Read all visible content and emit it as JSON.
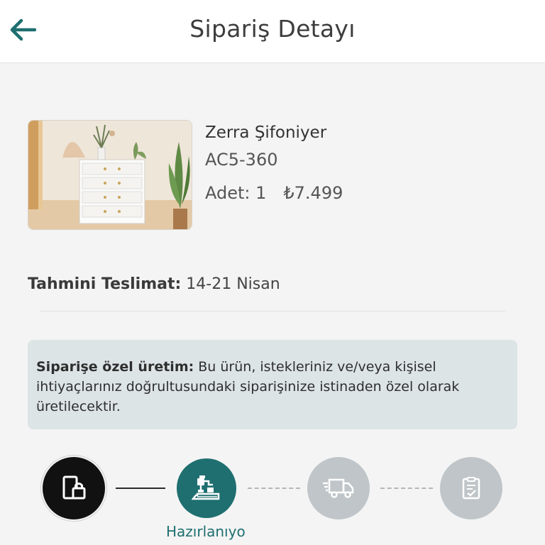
{
  "header": {
    "title": "Sipariş Detayı",
    "back_icon": "arrow-left-icon"
  },
  "product": {
    "name": "Zerra Şifoniyer",
    "code": "AC5-360",
    "quantity": "Adet: 1",
    "price": "₺7.499"
  },
  "delivery": {
    "label": "Tahmini Teslimat:",
    "value": "14-21 Nisan"
  },
  "notice": {
    "bold": "Siparişe özel üretim:",
    "text": "Bu ürün, istekleriniz ve/veya kişisel ihtiyaçlarınız doğrultusundaki siparişinize istinaden özel olarak üretilecektir."
  },
  "progress": {
    "steps": [
      {
        "icon": "order-received-icon",
        "state": "done"
      },
      {
        "icon": "production-machine-icon",
        "state": "active",
        "label": "Hazırlanıyo"
      },
      {
        "icon": "delivery-truck-icon",
        "state": "pending"
      },
      {
        "icon": "checklist-icon",
        "state": "pending"
      }
    ]
  },
  "colors": {
    "accent": "#1f6f70",
    "notice_bg": "#dde4e6",
    "pending": "#bfc5c8",
    "done": "#111111"
  }
}
